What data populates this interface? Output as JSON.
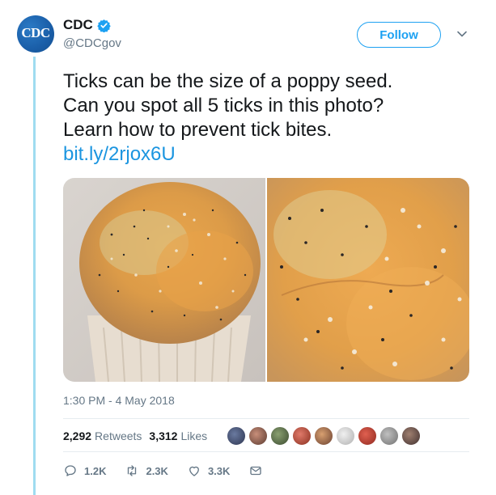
{
  "account": {
    "avatar_text": "CDC",
    "name": "CDC",
    "handle": "@CDCgov",
    "verified": true
  },
  "header": {
    "follow_label": "Follow",
    "menu_icon": "chevron-down-icon"
  },
  "tweet": {
    "lines": [
      "Ticks can be the size of a poppy seed.",
      "Can you spot all 5 ticks in this photo?",
      "Learn how to prevent tick bites."
    ],
    "link": "bit.ly/2rjox6U",
    "timestamp": "1:30 PM - 4 May 2018"
  },
  "stats": {
    "retweets_count": "2,292",
    "retweets_label": "Retweets",
    "likes_count": "3,312",
    "likes_label": "Likes"
  },
  "actions": {
    "reply_count": "1.2K",
    "retweet_count": "2.3K",
    "like_count": "3.3K"
  },
  "colors": {
    "accent": "#1da1f2",
    "link": "#1b95e0",
    "muted": "#657786",
    "thread_line": "#9fdcf0"
  }
}
